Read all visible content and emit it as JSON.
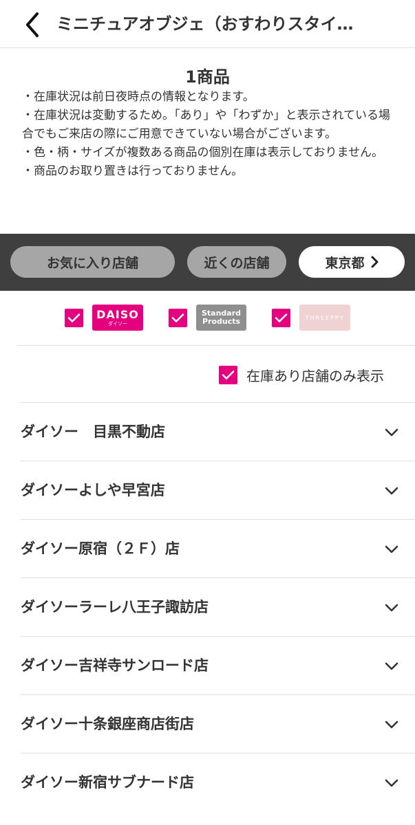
{
  "header": {
    "title": "ミニチュアオブジェ（おすわりスタイ…"
  },
  "notice": {
    "count": "1商品",
    "lines": [
      "・在庫状況は前日夜時点の情報となります。",
      "・在庫状況は変動するため。「あり」や「わずか」と表示されている場合でもご来店の際にご用意できていない場合がございます。",
      "・色・柄・サイズが複数ある商品の個別在庫は表示しておりません。",
      "・商品のお取り置きは行っておりません。"
    ]
  },
  "filters": {
    "favorites": "お気に入り店舗",
    "nearby": "近くの店舗",
    "prefecture": "東京都"
  },
  "brands": [
    {
      "name": "DAISO",
      "sub": "ダイソー",
      "checked": true,
      "color": "#e4007f"
    },
    {
      "name_line1": "Standard",
      "name_line2": "Products",
      "checked": true,
      "color": "#8f8f8f"
    },
    {
      "name": "THREEPPY",
      "checked": true,
      "color": "#efd3d3"
    }
  ],
  "instock_filter": {
    "label": "在庫あり店舗のみ表示",
    "checked": true
  },
  "stores": [
    "ダイソー　目黒不動店",
    "ダイソーよしや早宮店",
    "ダイソー原宿（２Ｆ）店",
    "ダイソーラーレ八王子諏訪店",
    "ダイソー吉祥寺サンロード店",
    "ダイソー十条銀座商店街店",
    "ダイソー新宿サブナード店"
  ],
  "colors": {
    "accent": "#e4007f",
    "filter_bar": "#3f3f3f",
    "pill_inactive": "#a6a6a6"
  }
}
